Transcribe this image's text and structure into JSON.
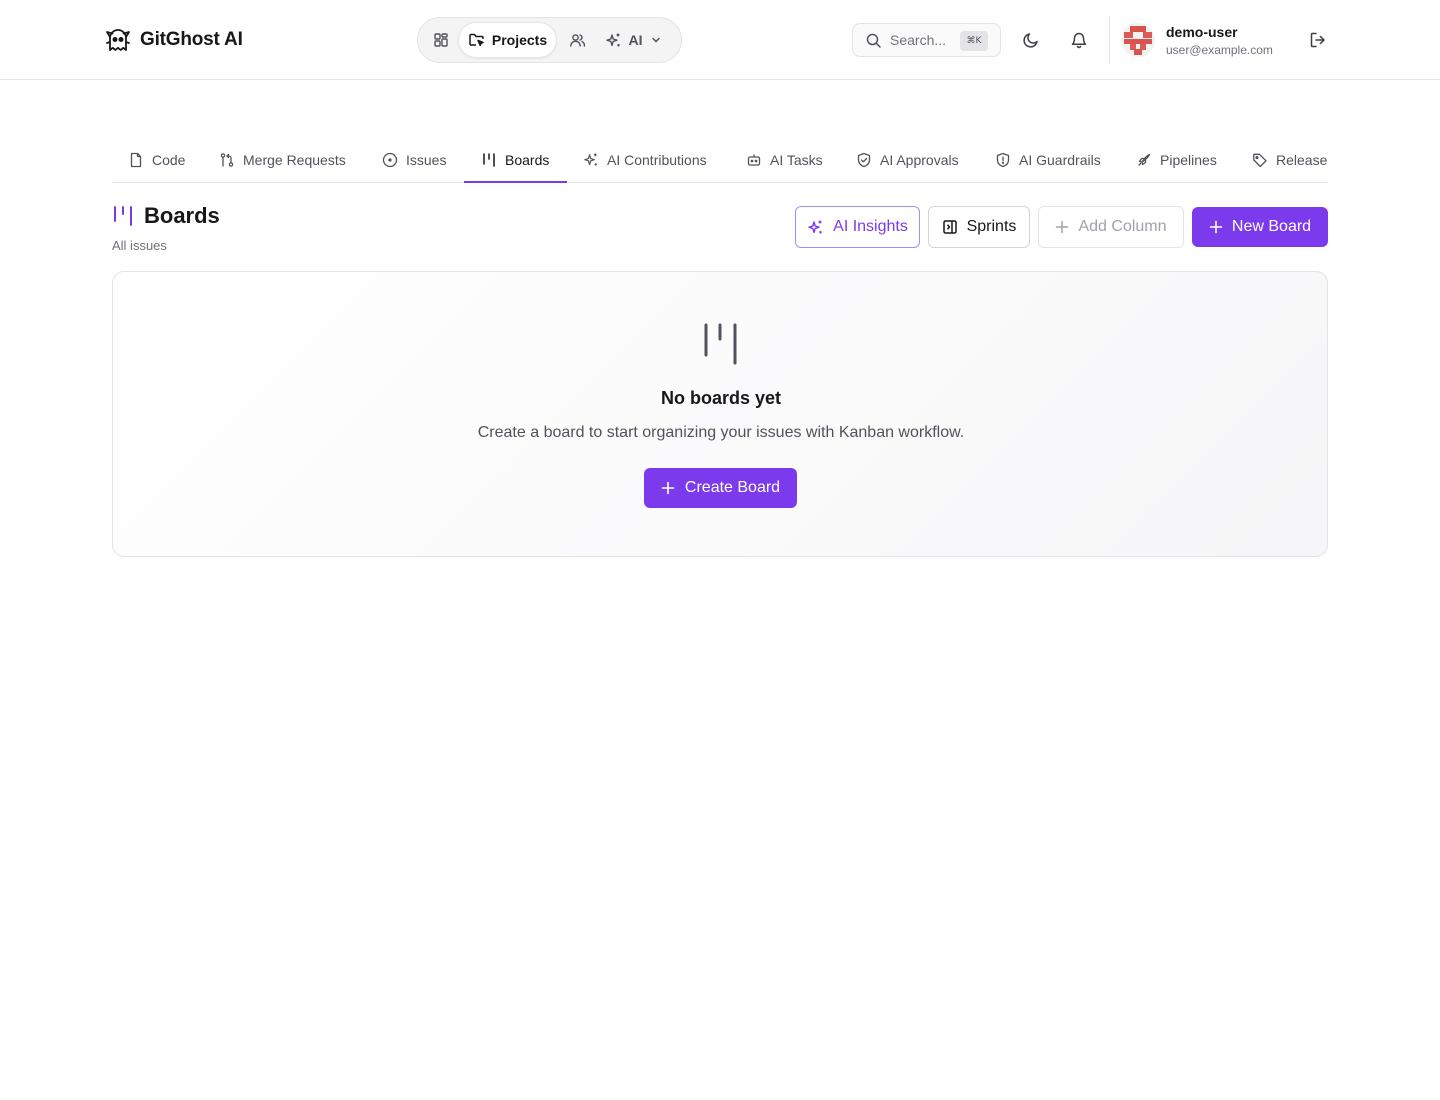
{
  "app": {
    "name": "GitGhost AI",
    "logo_icon": "ghost-icon"
  },
  "nav": {
    "dashboard_icon": "dashboard-icon",
    "projects_label": "Projects",
    "team_icon": "users-icon",
    "ai_label": "AI"
  },
  "search": {
    "placeholder": "Search...",
    "shortcut": "⌘K"
  },
  "user": {
    "name": "demo-user",
    "email": "user@example.com"
  },
  "tabs": [
    {
      "label": "Code",
      "icon": "file-icon",
      "active": false
    },
    {
      "label": "Merge Requests",
      "icon": "git-pull-request-icon",
      "active": false
    },
    {
      "label": "Issues",
      "icon": "circle-dot-icon",
      "active": false
    },
    {
      "label": "Boards",
      "icon": "kanban-icon",
      "active": true
    },
    {
      "label": "AI Contributions",
      "icon": "sparkles-icon",
      "active": false
    },
    {
      "label": "AI Tasks",
      "icon": "bot-icon",
      "active": false
    },
    {
      "label": "AI Approvals",
      "icon": "shield-check-icon",
      "active": false
    },
    {
      "label": "AI Guardrails",
      "icon": "shield-alert-icon",
      "active": false
    },
    {
      "label": "Pipelines",
      "icon": "rocket-icon",
      "active": false
    },
    {
      "label": "Release",
      "icon": "tag-icon",
      "active": false
    }
  ],
  "header": {
    "title": "Boards",
    "subtitle": "All issues"
  },
  "actions": {
    "insights_label": "AI Insights",
    "sprints_label": "Sprints",
    "add_column_label": "Add Column",
    "new_board_label": "New Board"
  },
  "empty_state": {
    "title": "No boards yet",
    "description": "Create a board to start organizing your issues with Kanban workflow.",
    "button_label": "Create Board"
  },
  "colors": {
    "accent": "#7c3aed",
    "border": "#e4e4e7",
    "muted_text": "#71717a"
  }
}
